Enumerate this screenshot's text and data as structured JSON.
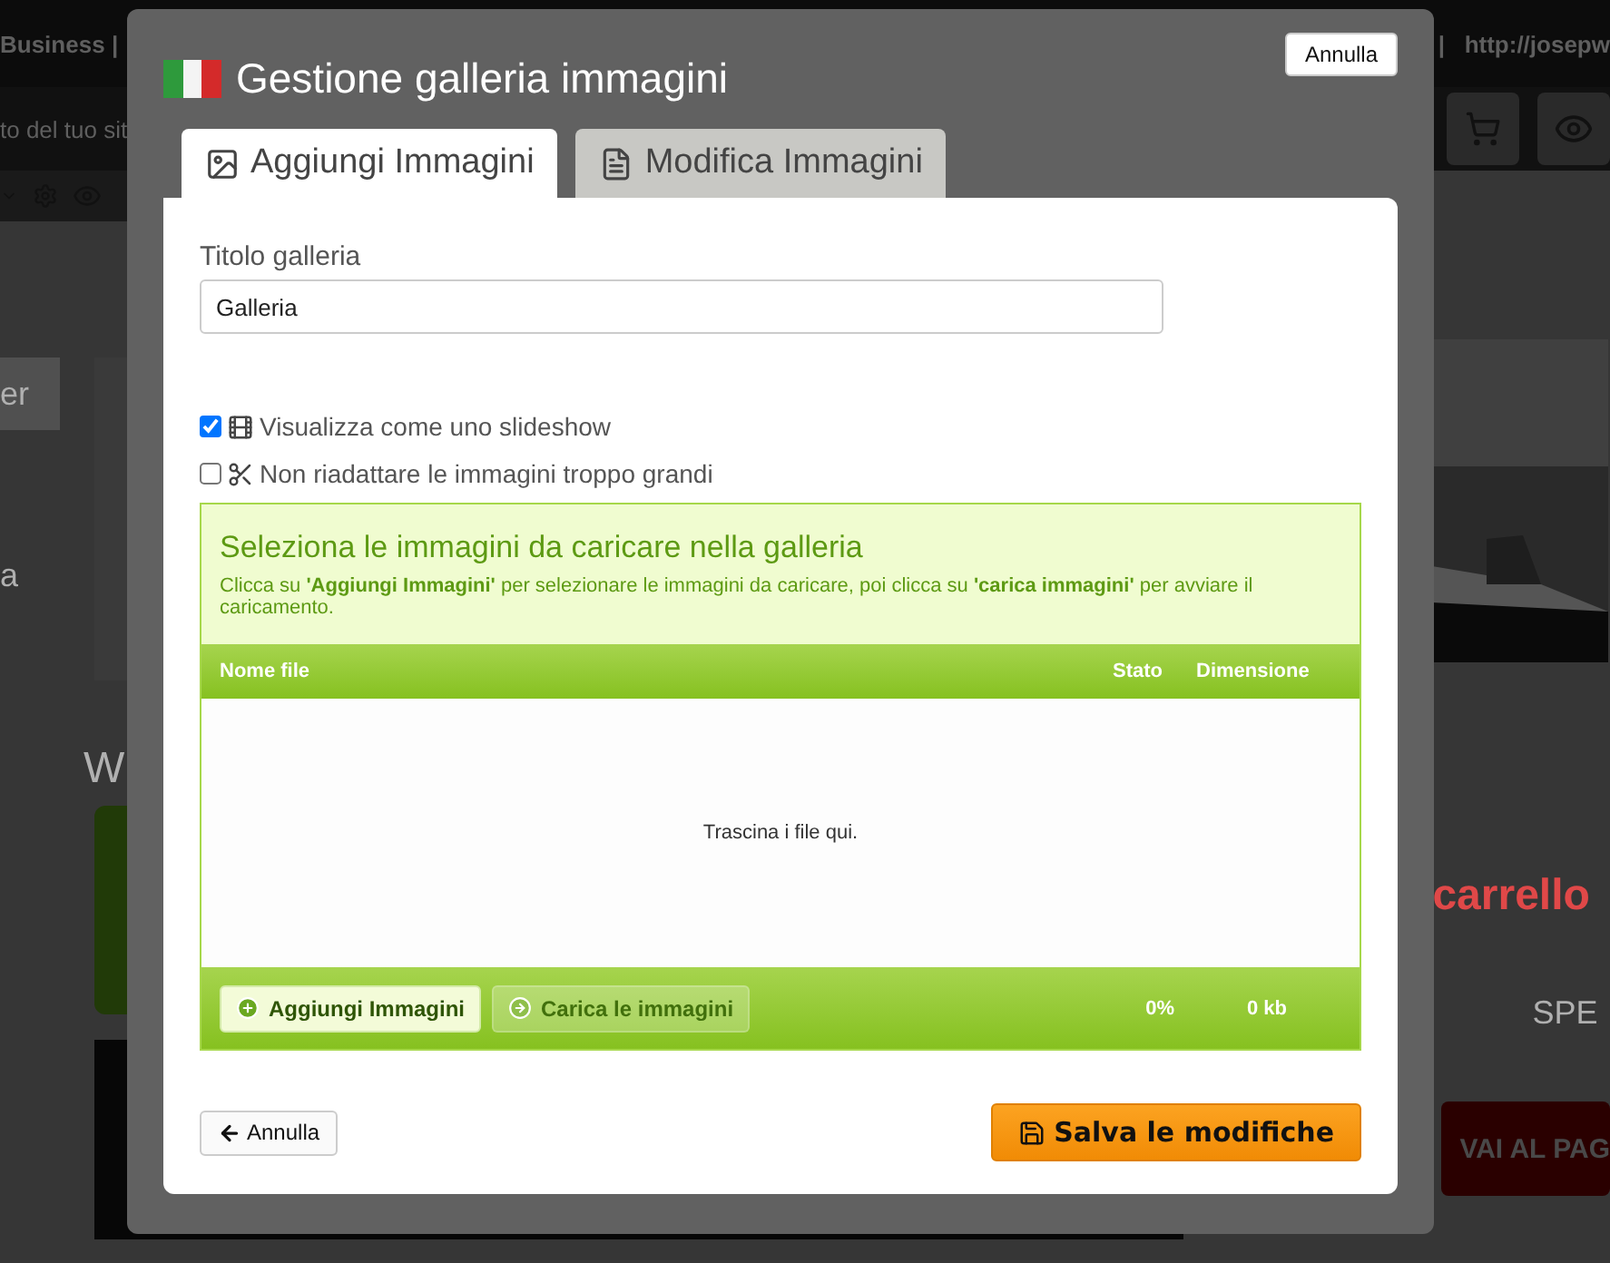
{
  "background_page": {
    "top_bar": {
      "left_text": "Business",
      "left_separator": "|",
      "right_separator": "|",
      "url": "http://josepw"
    },
    "sub_bar_text": "to del tuo sit",
    "menu_items": [
      {
        "label": "er",
        "selected": true
      },
      {
        "label": "a",
        "selected": false
      }
    ],
    "heading": "W",
    "cart_title": "carrello",
    "shipping_label": "SPE",
    "checkout_button": "VAI AL PAG"
  },
  "dialog": {
    "title": "Gestione galleria immagini",
    "close_button": "Annulla",
    "tabs": [
      {
        "label": "Aggiungi Immagini",
        "selected": true
      },
      {
        "label": "Modifica Immagini",
        "selected": false
      }
    ],
    "gallery_title_label": "Titolo galleria",
    "gallery_title_value": "Galleria",
    "options": [
      {
        "label": "Visualizza come uno slideshow",
        "checked": true
      },
      {
        "label": "Non riadattare le immagini troppo grandi",
        "checked": false
      }
    ],
    "uploader": {
      "heading": "Seleziona le immagini da caricare nella galleria",
      "instructions": "Clicca su **'Aggiungi Immagini'** per selezionare le immagini da caricare, poi clicca su **'carica immagini'** per avviare il caricamento.",
      "columns": [
        "Nome file",
        "Stato",
        "Dimensione"
      ],
      "drop_hint": "Trascina i file qui.",
      "buttons": [
        {
          "label": "Aggiungi Immagini",
          "disabled": false
        },
        {
          "label": "Carica le immagini",
          "disabled": true
        }
      ],
      "total_percent": "0%",
      "total_size": "0 kb"
    },
    "cancel_button": "Annulla",
    "save_button": "Salva le modifiche"
  }
}
